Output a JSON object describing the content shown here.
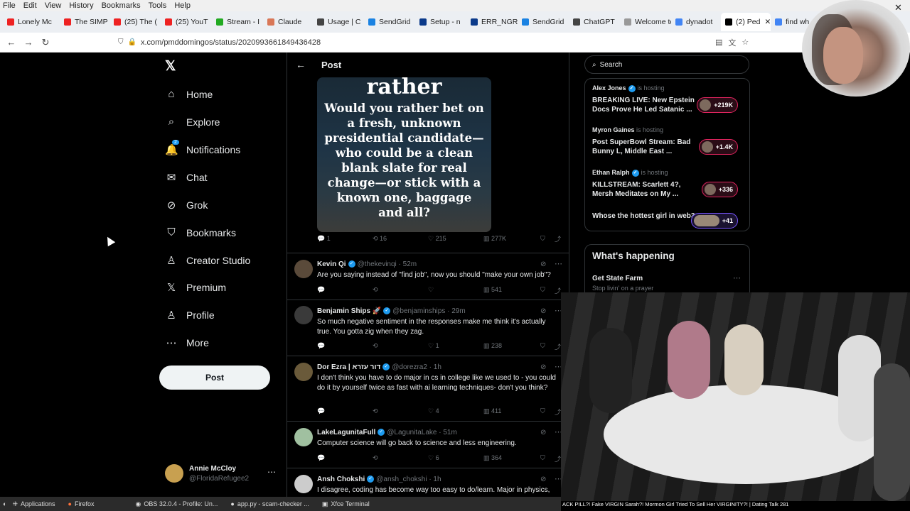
{
  "menubar": [
    "File",
    "Edit",
    "View",
    "History",
    "Bookmarks",
    "Tools",
    "Help"
  ],
  "tabs": [
    {
      "label": "Lonely Mc",
      "color": "#e22"
    },
    {
      "label": "The SIMP",
      "color": "#e22"
    },
    {
      "label": "(25) The (",
      "color": "#e22"
    },
    {
      "label": "(25) YouT",
      "color": "#e22"
    },
    {
      "label": "Stream - I",
      "color": "#22a"
    },
    {
      "label": "Claude",
      "color": "#d97757"
    },
    {
      "label": "Usage | C",
      "color": "#444"
    },
    {
      "label": "SendGrid",
      "color": "#1a82e2"
    },
    {
      "label": "Setup - n",
      "color": "#0b3a8a"
    },
    {
      "label": "ERR_NGR",
      "color": "#0b3a8a"
    },
    {
      "label": "SendGrid",
      "color": "#1a82e2"
    },
    {
      "label": "ChatGPT",
      "color": "#444"
    },
    {
      "label": "Welcome to",
      "color": "#888"
    },
    {
      "label": "dynadot",
      "color": "#4285f4"
    },
    {
      "label": "(2) Ped",
      "color": "#000"
    },
    {
      "label": "find wh",
      "color": "#4285f4"
    }
  ],
  "url": "x.com/pmddomingos/status/2020993661849436428",
  "x_logo": "𝕏",
  "nav": [
    {
      "label": "Home",
      "icon": "⌂"
    },
    {
      "label": "Explore",
      "icon": "⌕"
    },
    {
      "label": "Notifications",
      "icon": "🔔"
    },
    {
      "label": "Chat",
      "icon": "✉"
    },
    {
      "label": "Grok",
      "icon": "⊘"
    },
    {
      "label": "Bookmarks",
      "icon": "⛉"
    },
    {
      "label": "Creator Studio",
      "icon": "♙"
    },
    {
      "label": "Premium",
      "icon": "𝕏"
    },
    {
      "label": "Profile",
      "icon": "♙"
    },
    {
      "label": "More",
      "icon": "⋯"
    }
  ],
  "post_button": "Post",
  "account": {
    "name": "Annie McCloy",
    "handle": "@FloridaRefugee2"
  },
  "header_title": "Post",
  "image_card": {
    "big": "rather",
    "body": "Would you rather bet on a fresh, unknown presidential candidate—who could be a clean blank slate for real change—or stick with a known one, baggage and all?"
  },
  "main_stats": {
    "replies": "1",
    "reposts": "16",
    "likes": "215",
    "views": "277K"
  },
  "replies": [
    {
      "name": "Kevin Qi",
      "handle": "@thekevinqi · 52m",
      "text": "Are you saying instead of \"find job\", now you should \"make your own job\"?",
      "reposts": "",
      "likes": "",
      "views": "541",
      "av": "#5a4a3a"
    },
    {
      "name": "Benjamin Ships 🚀",
      "handle": "@benjaminships · 29m",
      "text": "So much negative sentiment in the responses make me think it's actually true.  You gotta zig when they zag.",
      "reposts": "",
      "likes": "1",
      "views": "238",
      "av": "#3a3a3a"
    },
    {
      "name": "Dor Ezra | דור עזרא",
      "handle": "@dorezra2 · 1h",
      "text": "I don't think you have to do major in cs  in college like we used to - you could do it by yourself twice as fast with ai learning techniques- don't you think?",
      "reposts": "",
      "likes": "4",
      "views": "411",
      "av": "#6a5a3a"
    },
    {
      "name": "LakeLagunitaFull",
      "handle": "@LagunitaLake · 51m",
      "text": "Computer science will go back to science and less engineering.",
      "reposts": "",
      "likes": "6",
      "views": "364",
      "av": "#a0c0a0"
    },
    {
      "name": "Ansh Chokshi",
      "handle": "@ansh_chokshi · 1h",
      "text": "I disagree, coding has become way too easy to do/learn. Major in physics,",
      "reposts": "",
      "likes": "",
      "views": "",
      "av": "#cccccc"
    }
  ],
  "search_placeholder": "Search",
  "spaces": [
    {
      "host": "Alex Jones",
      "hosting": "is hosting",
      "title": "BREAKING LIVE: New Epstein Docs Prove He Led Satanic ...",
      "count": "+219K"
    },
    {
      "host": "Myron Gaines",
      "hosting": "is hosting",
      "title": "Post SuperBowl Stream: Bad Bunny L, Middle East ...",
      "count": "+1.4K"
    },
    {
      "host": "Ethan Ralph",
      "hosting": "is hosting",
      "title": "KILLSTREAM: Scarlett 4?, Mersh Meditates on My ...",
      "count": "+336"
    },
    {
      "host": "",
      "hosting": "",
      "title": "Whose the hottest girl in web3",
      "count": "+41"
    }
  ],
  "happening": {
    "title": "What's happening",
    "item": "Get State Farm",
    "sub": "Stop livin' on a prayer"
  },
  "video_caption": "ACK PILL?! Fake VIRGIN Sarah?! Mormon Girl Tried To Sell Her VIRGINITY?! | Dating Talk 281",
  "taskbar": [
    "Applications",
    "Firefox",
    "OBS 32.0.4 - Profile: Un...",
    "app.py - scam-checker ...",
    "Xfce Terminal"
  ],
  "notification_count": "2"
}
